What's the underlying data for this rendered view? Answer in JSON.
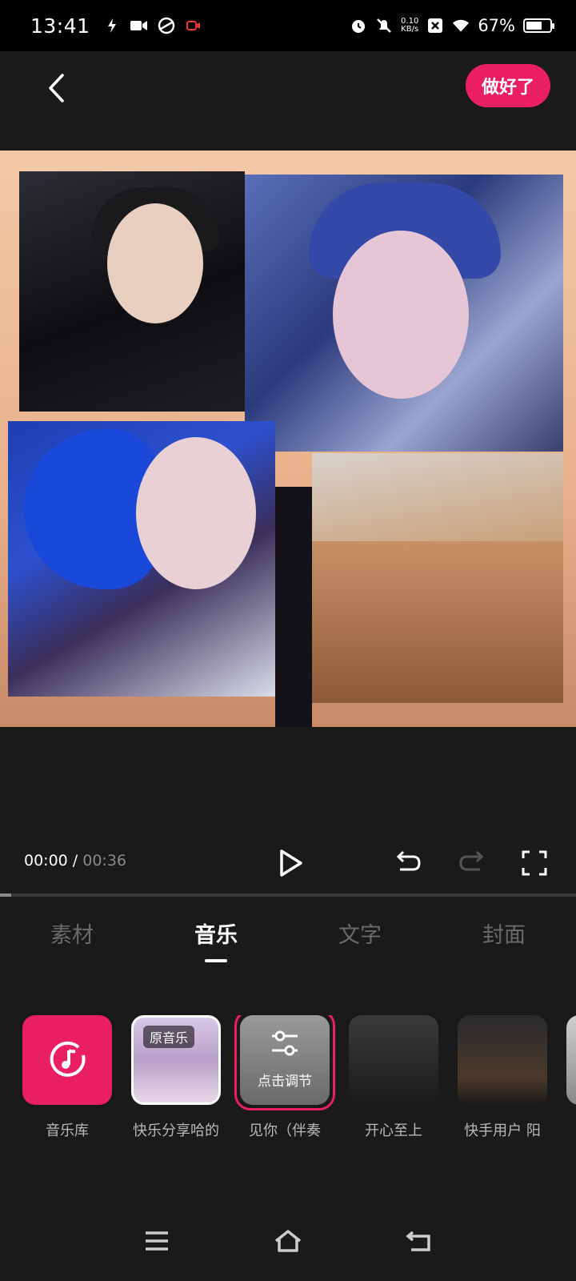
{
  "status_bar": {
    "time": "13:41",
    "net_speed_value": "0.10",
    "net_speed_unit": "KB/s",
    "battery_percent": "67%",
    "battery_level": 0.67,
    "icons": [
      "flash-icon",
      "video-icon",
      "app-icon",
      "record-icon",
      "alarm-icon",
      "mute-icon",
      "close-box-icon",
      "wifi-icon",
      "battery-icon"
    ]
  },
  "header": {
    "done_label": "做好了"
  },
  "player": {
    "current_time": "00:00",
    "separator": " / ",
    "total_time": "00:36",
    "progress": 0.02
  },
  "tabs": [
    {
      "label": "素材",
      "active": false
    },
    {
      "label": "音乐",
      "active": true
    },
    {
      "label": "文字",
      "active": false
    },
    {
      "label": "封面",
      "active": false
    }
  ],
  "music": {
    "items": [
      {
        "label": "音乐库",
        "icon": "music-note-icon"
      },
      {
        "label": "快乐分享哈的",
        "badge": "原音乐"
      },
      {
        "label": "见你（伴奏",
        "overlay": "点击调节",
        "selected": true
      },
      {
        "label": "开心至上"
      },
      {
        "label": "快手用户 阳"
      }
    ]
  },
  "colors": {
    "accent": "#e91e63",
    "background": "#1a1a1a"
  }
}
